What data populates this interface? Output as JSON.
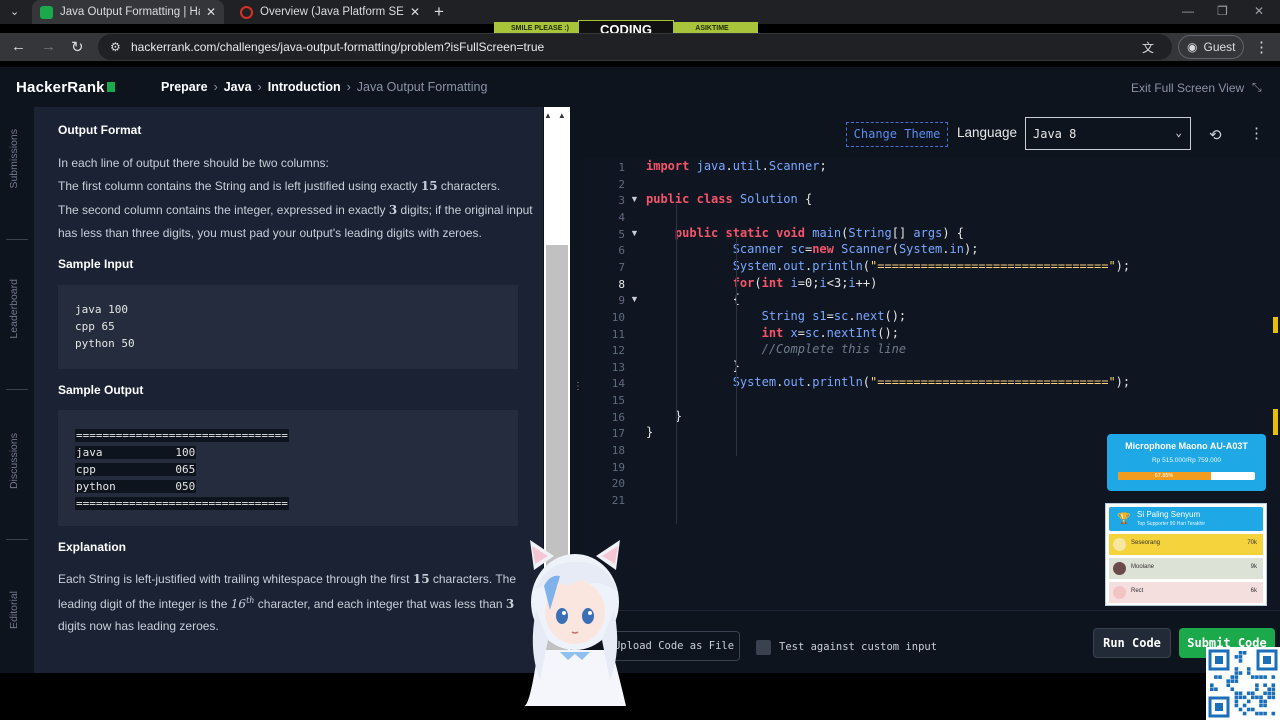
{
  "browser": {
    "tabs": [
      {
        "title": "Java Output Formatting | Hacke",
        "favicon_color": "#1ba94c",
        "active": true
      },
      {
        "title": "Overview (Java Platform SE 8 )",
        "favicon_color": "#d93025",
        "active": false
      }
    ],
    "new_tab": "+",
    "url": "hackerrank.com/challenges/java-output-formatting/problem?isFullScreen=true",
    "profile": "Guest"
  },
  "stream_banner": {
    "left": "SMILE PLEASE :)",
    "center": "CODING",
    "right": "ASIKTIME"
  },
  "header": {
    "logo": "HackerRank",
    "breadcrumbs": [
      "Prepare",
      "Java",
      "Introduction",
      "Java Output Formatting"
    ],
    "exit_fullscreen": "Exit Full Screen View"
  },
  "side_tabs": [
    "Submissions",
    "Leaderboard",
    "Discussions",
    "Editorial"
  ],
  "problem": {
    "output_format_heading": "Output Format",
    "output_lines": [
      "In each line of output there should be two columns:",
      [
        "The first column contains the String and is left justified using exactly ",
        "15",
        " characters."
      ],
      [
        "The second column contains the integer, expressed in exactly ",
        "3",
        " digits; if the original input"
      ],
      "has less than three digits, you must pad your output's leading digits with zeroes."
    ],
    "sample_input_heading": "Sample Input",
    "sample_input": [
      "java 100",
      "cpp 65",
      "python 50"
    ],
    "sample_output_heading": "Sample Output",
    "sample_output": [
      "================================",
      "java           100",
      "cpp            065",
      "python         050",
      "================================"
    ],
    "explanation_heading": "Explanation",
    "explanation_lines": [
      [
        "Each String is left-justified with trailing whitespace through the first ",
        "15",
        " characters. The"
      ],
      [
        "leading digit of the integer is the ",
        "16",
        "th",
        " character, and each integer that was less than ",
        "3"
      ],
      "digits now has leading zeroes."
    ]
  },
  "editor": {
    "change_theme": "Change Theme",
    "language_label": "Language",
    "language": "Java 8",
    "active_line": 8,
    "line_numbers": [
      "1",
      "2",
      "3",
      "4",
      "5",
      "6",
      "7",
      "8",
      "9",
      "10",
      "11",
      "12",
      "13",
      "14",
      "15",
      "16",
      "17",
      "18",
      "19",
      "20",
      "21"
    ],
    "code": [
      "import java.util.Scanner;",
      "",
      "public class Solution {",
      "",
      "    public static void main(String[] args) {",
      "            Scanner sc=new Scanner(System.in);",
      "            System.out.println(\"================================\");",
      "            for(int i=0;i<3;i++)",
      "            {",
      "                String s1=sc.next();",
      "                int x=sc.nextInt();",
      "                //Complete this line",
      "            }",
      "            System.out.println(\"================================\");",
      "",
      "    }",
      "}",
      "",
      "",
      "",
      ""
    ],
    "upload_label": "Upload Code as File",
    "custom_input_label": "Test against custom input",
    "run_label": "Run Code",
    "submit_label": "Submit Code"
  },
  "overlay_donation": {
    "title": "Microphone Maono AU-A03T",
    "amount": "Rp 515.000/Rp 759.000",
    "percent_label": "67.85%",
    "progress": 0.6785
  },
  "overlay_leaderboard": {
    "title": "Si Paling Senyum",
    "subtitle": "Top Supporter 90 Hari Terakhir",
    "rows": [
      {
        "name": "Seseorang",
        "score": "70k",
        "bg": "#f5d33c",
        "avatar": "#f7e7a0"
      },
      {
        "name": "Moolane",
        "score": "9k",
        "bg": "#dde2d6",
        "avatar": "#6b4a4a"
      },
      {
        "name": "Rect",
        "score": "6k",
        "bg": "#f4dede",
        "avatar": "#f2c4c4"
      }
    ]
  },
  "colors": {
    "hr_green": "#1ba94c",
    "accent_blue": "#5b8def",
    "editor_bg": "#0f1621",
    "panel_bg": "#1a2233"
  }
}
